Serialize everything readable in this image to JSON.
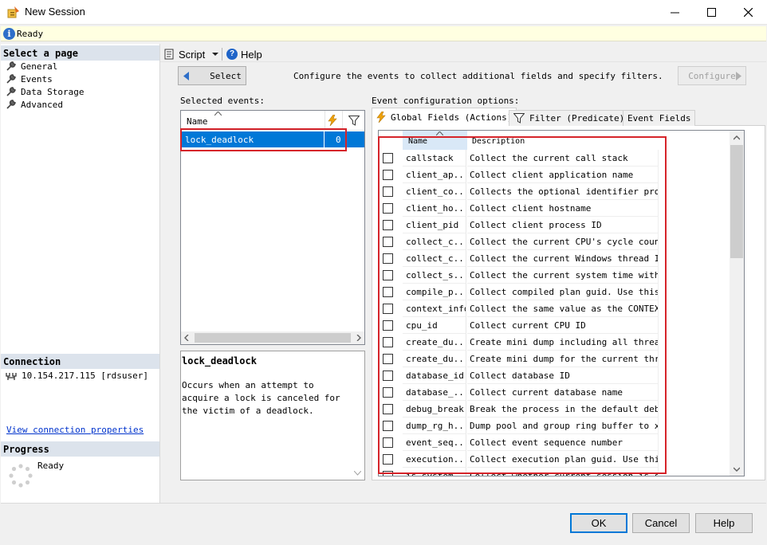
{
  "window": {
    "title": "New Session",
    "status": "Ready"
  },
  "left": {
    "select_page": "Select a page",
    "pages": [
      "General",
      "Events",
      "Data Storage",
      "Advanced"
    ],
    "connection_label": "Connection",
    "connection_value": "10.154.217.115 [rdsuser]",
    "view_connection": "View connection properties",
    "progress_label": "Progress",
    "progress_status": "Ready"
  },
  "toolbar": {
    "script_label": "Script",
    "help_label": "Help"
  },
  "main": {
    "select_button": "Select",
    "config_description": "Configure the events to collect additional fields and specify filters.",
    "configure_button": "Configure",
    "selected_events_label": "Selected events:",
    "name_header": "Name",
    "selected_event": {
      "name": "lock_deadlock",
      "count": "0"
    },
    "event_desc_title": "lock_deadlock",
    "event_desc_text": "Occurs when an attempt to acquire a lock is canceled for the victim of a deadlock."
  },
  "config": {
    "label": "Event configuration options:",
    "tabs": [
      "Global Fields (Actions)",
      "Filter (Predicate)",
      "Event Fields"
    ],
    "columns": [
      "Name",
      "Description"
    ],
    "rows": [
      {
        "name": "callstack",
        "desc": "Collect the current call stack"
      },
      {
        "name": "client_ap...",
        "desc": "Collect client application name"
      },
      {
        "name": "client_co...",
        "desc": "Collects the optional identifier pro..."
      },
      {
        "name": "client_ho...",
        "desc": "Collect client hostname"
      },
      {
        "name": "client_pid",
        "desc": "Collect client process ID"
      },
      {
        "name": "collect_c...",
        "desc": "Collect the current CPU's cycle count"
      },
      {
        "name": "collect_c...",
        "desc": "Collect the current Windows thread ID"
      },
      {
        "name": "collect_s...",
        "desc": "Collect the current system time with..."
      },
      {
        "name": "compile_p...",
        "desc": "Collect compiled plan guid. Use this..."
      },
      {
        "name": "context_info",
        "desc": "Collect the same value as the CONTEX..."
      },
      {
        "name": "cpu_id",
        "desc": "Collect current CPU ID"
      },
      {
        "name": "create_du...",
        "desc": "Create mini dump including all threads"
      },
      {
        "name": "create_du...",
        "desc": "Create mini dump for the current thread"
      },
      {
        "name": "database_id",
        "desc": "Collect database ID"
      },
      {
        "name": "database_...",
        "desc": "Collect current database name"
      },
      {
        "name": "debug_break",
        "desc": "Break the process in the default deb..."
      },
      {
        "name": "dump_rg_h...",
        "desc": "Dump pool and group ring buffer to x..."
      },
      {
        "name": "event_seq...",
        "desc": "Collect event sequence number"
      },
      {
        "name": "execution...",
        "desc": "Collect execution plan guid. Use thi..."
      },
      {
        "name": "is_system",
        "desc": "Collect whether current session is s..."
      }
    ]
  },
  "dialog": {
    "ok": "OK",
    "cancel": "Cancel",
    "help": "Help"
  },
  "colors": {
    "selection": "#0078d7",
    "highlight": "#d6242a",
    "header_bg": "#dce3ec",
    "status_bg": "#ffffe1"
  }
}
